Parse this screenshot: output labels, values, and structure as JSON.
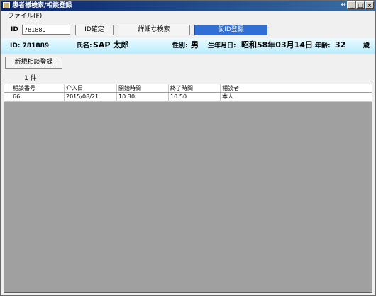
{
  "window": {
    "title": "患者様検索/相談登録",
    "resize_glyph": "↔"
  },
  "window_controls": {
    "minimize": "_",
    "maximize": "□",
    "close": "×"
  },
  "menu": {
    "items": [
      "ファイル(F)"
    ]
  },
  "toolbar": {
    "id_label": "ID",
    "id_value": "781889",
    "confirm_button": "ID確定",
    "detail_search_button": "詳細な検索",
    "temp_register_button": "仮ID登録"
  },
  "patient": {
    "id_text": "ID: 781889",
    "name_label": "氏名:",
    "name_value": "SAP 太郎",
    "sex_label": "性別:",
    "sex_value": "男",
    "birth_label": "生年月日:",
    "birth_value": "昭和58年03月14日",
    "age_label": "年齢:",
    "age_value": "32",
    "age_unit": "歳"
  },
  "new_consult_button": "新規相談登録",
  "count": "1 件",
  "table": {
    "columns": [
      "相談番号",
      "介入日",
      "開始時間",
      "終了時間",
      "相談者"
    ],
    "rows": [
      [
        "66",
        "2015/08/21",
        "10:30",
        "10:50",
        "本人"
      ]
    ]
  },
  "colors": {
    "title_bar": "#08246b",
    "primary_button": "#2f6fd6",
    "patient_bar": "#b7ecff",
    "table_empty_area": "#a0a0a0"
  }
}
